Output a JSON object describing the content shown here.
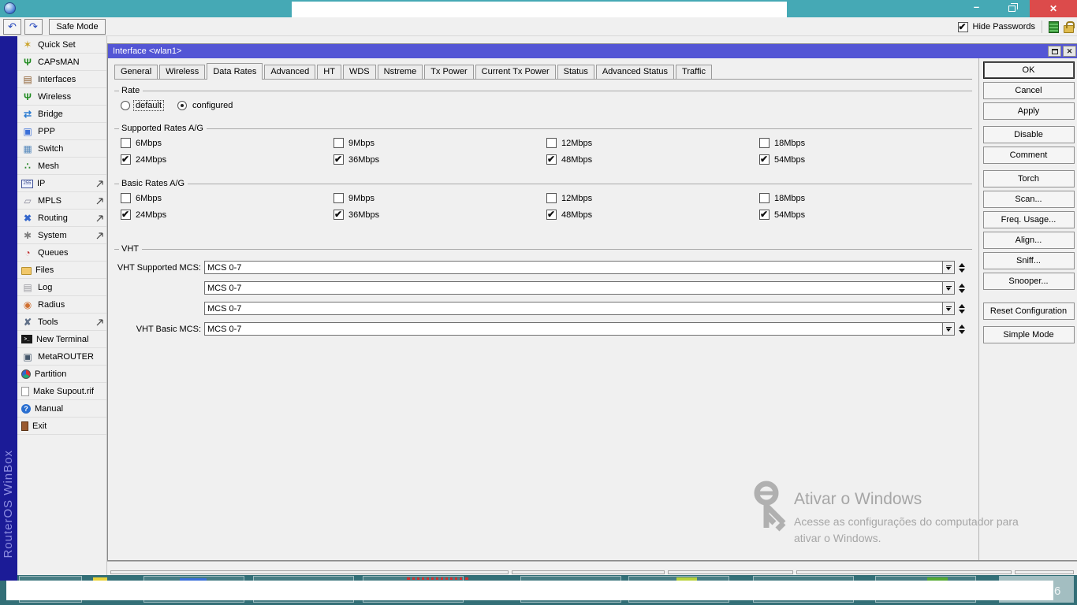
{
  "app": {
    "hide_passwords_label": "Hide Passwords",
    "safe_mode_label": "Safe Mode"
  },
  "sidebar": {
    "brand": "RouterOS WinBox",
    "items": [
      {
        "label": "Quick Set",
        "icon": "quick-set",
        "submenu": false
      },
      {
        "label": "CAPsMAN",
        "icon": "capsman",
        "submenu": false
      },
      {
        "label": "Interfaces",
        "icon": "interfaces",
        "submenu": false
      },
      {
        "label": "Wireless",
        "icon": "wireless",
        "submenu": false
      },
      {
        "label": "Bridge",
        "icon": "bridge",
        "submenu": false
      },
      {
        "label": "PPP",
        "icon": "ppp",
        "submenu": false
      },
      {
        "label": "Switch",
        "icon": "switch",
        "submenu": false
      },
      {
        "label": "Mesh",
        "icon": "mesh",
        "submenu": false
      },
      {
        "label": "IP",
        "icon": "ip",
        "submenu": true
      },
      {
        "label": "MPLS",
        "icon": "mpls",
        "submenu": true
      },
      {
        "label": "Routing",
        "icon": "routing",
        "submenu": true
      },
      {
        "label": "System",
        "icon": "system",
        "submenu": true
      },
      {
        "label": "Queues",
        "icon": "queues",
        "submenu": false
      },
      {
        "label": "Files",
        "icon": "files",
        "submenu": false
      },
      {
        "label": "Log",
        "icon": "log",
        "submenu": false
      },
      {
        "label": "Radius",
        "icon": "radius",
        "submenu": false
      },
      {
        "label": "Tools",
        "icon": "tools",
        "submenu": true
      },
      {
        "label": "New Terminal",
        "icon": "terminal",
        "submenu": false
      },
      {
        "label": "MetaROUTER",
        "icon": "metarouter",
        "submenu": false
      },
      {
        "label": "Partition",
        "icon": "partition",
        "submenu": false
      },
      {
        "label": "Make Supout.rif",
        "icon": "supout",
        "submenu": false
      },
      {
        "label": "Manual",
        "icon": "manual",
        "submenu": false
      },
      {
        "label": "Exit",
        "icon": "exit",
        "submenu": false
      }
    ]
  },
  "dialog": {
    "title": "Interface <wlan1>",
    "tabs": [
      {
        "label": "General",
        "active": false
      },
      {
        "label": "Wireless",
        "active": false
      },
      {
        "label": "Data Rates",
        "active": true
      },
      {
        "label": "Advanced",
        "active": false
      },
      {
        "label": "HT",
        "active": false
      },
      {
        "label": "WDS",
        "active": false
      },
      {
        "label": "Nstreme",
        "active": false
      },
      {
        "label": "Tx Power",
        "active": false
      },
      {
        "label": "Current Tx Power",
        "active": false
      },
      {
        "label": "Status",
        "active": false
      },
      {
        "label": "Advanced Status",
        "active": false
      },
      {
        "label": "Traffic",
        "active": false
      }
    ],
    "rate": {
      "legend": "Rate",
      "options": [
        {
          "label": "default",
          "selected": false,
          "focused": true
        },
        {
          "label": "configured",
          "selected": true,
          "focused": false
        }
      ]
    },
    "supported_rates": {
      "legend": "Supported Rates A/G",
      "items": [
        {
          "label": "6Mbps",
          "checked": false
        },
        {
          "label": "9Mbps",
          "checked": false
        },
        {
          "label": "12Mbps",
          "checked": false
        },
        {
          "label": "18Mbps",
          "checked": false
        },
        {
          "label": "24Mbps",
          "checked": true
        },
        {
          "label": "36Mbps",
          "checked": true
        },
        {
          "label": "48Mbps",
          "checked": true
        },
        {
          "label": "54Mbps",
          "checked": true
        }
      ]
    },
    "basic_rates": {
      "legend": "Basic Rates A/G",
      "items": [
        {
          "label": "6Mbps",
          "checked": false
        },
        {
          "label": "9Mbps",
          "checked": false
        },
        {
          "label": "12Mbps",
          "checked": false
        },
        {
          "label": "18Mbps",
          "checked": false
        },
        {
          "label": "24Mbps",
          "checked": true
        },
        {
          "label": "36Mbps",
          "checked": true
        },
        {
          "label": "48Mbps",
          "checked": true
        },
        {
          "label": "54Mbps",
          "checked": true
        }
      ]
    },
    "vht": {
      "legend": "VHT",
      "rows": [
        {
          "label": "VHT Supported MCS:",
          "value": "MCS 0-7"
        },
        {
          "label": "",
          "value": "MCS 0-7"
        },
        {
          "label": "",
          "value": "MCS 0-7"
        },
        {
          "label": "VHT Basic MCS:",
          "value": "MCS 0-7"
        }
      ]
    },
    "buttons": [
      {
        "label": "OK",
        "gap": 0,
        "default": true
      },
      {
        "label": "Cancel",
        "gap": 0,
        "default": false
      },
      {
        "label": "Apply",
        "gap": 0,
        "default": false
      },
      {
        "label": "Disable",
        "gap": 1,
        "default": false
      },
      {
        "label": "Comment",
        "gap": 0,
        "default": false
      },
      {
        "label": "Torch",
        "gap": 1,
        "default": false
      },
      {
        "label": "Scan...",
        "gap": 0,
        "default": false
      },
      {
        "label": "Freq. Usage...",
        "gap": 0,
        "default": false
      },
      {
        "label": "Align...",
        "gap": 0,
        "default": false
      },
      {
        "label": "Sniff...",
        "gap": 0,
        "default": false
      },
      {
        "label": "Snooper...",
        "gap": 0,
        "default": false
      },
      {
        "label": "Reset Configuration",
        "gap": 2,
        "default": false
      },
      {
        "label": "Simple Mode",
        "gap": 1,
        "default": false
      }
    ]
  },
  "watermark": {
    "title": "Ativar o Windows",
    "line1": "Acesse as configurações do computador para",
    "line2": "ativar o Windows."
  },
  "taskbar": {
    "faint_text": "6"
  },
  "colors": {
    "titlebar_teal": "#45a9b5",
    "close_red": "#dc4b4b",
    "dialog_titlebar": "#5355d5",
    "brand_navy": "#1b1b97",
    "desktop_teal": "#336f77"
  }
}
